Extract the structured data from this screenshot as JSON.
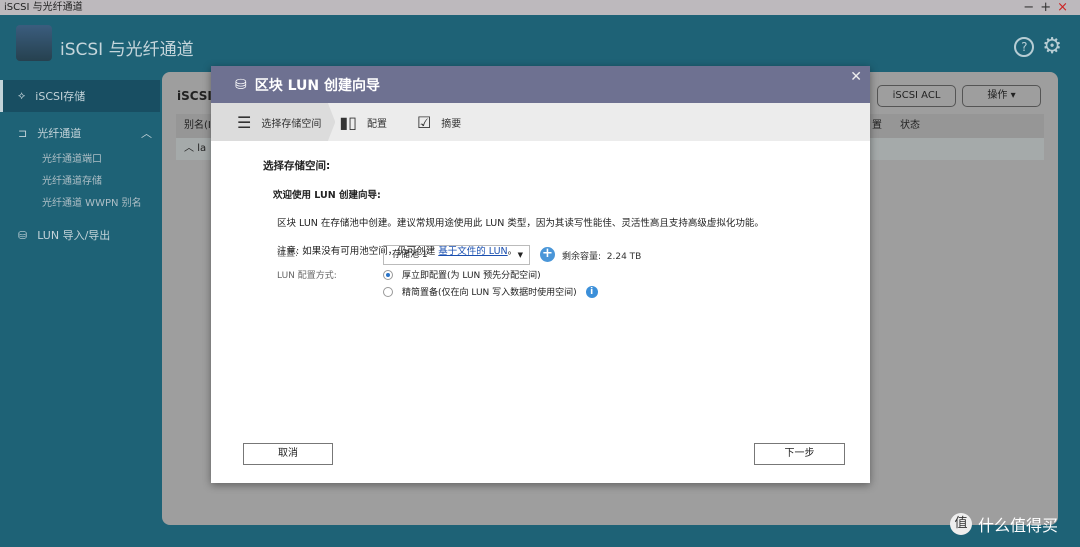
{
  "window": {
    "title": "iSCSI 与光纤通道",
    "controls": [
      "−",
      "+",
      "×"
    ]
  },
  "app": {
    "title": "iSCSI 与光纤通道"
  },
  "sidebar": {
    "items": [
      {
        "label": "iSCSI存储"
      },
      {
        "label": "光纤通道",
        "subitems": [
          "光纤通道端口",
          "光纤通道存储",
          "光纤通道 WWPN 别名"
        ]
      },
      {
        "label": "LUN 导入/导出"
      }
    ]
  },
  "panel": {
    "title": "iSCSI",
    "acl_button": "iSCSI ACL",
    "action_button": "操作",
    "columns": [
      "别名(IQ",
      "置",
      "状态"
    ],
    "row": "la"
  },
  "dialog": {
    "title": "区块 LUN 创建向导",
    "steps": [
      "选择存储空间",
      "配置",
      "摘要"
    ],
    "heading": "选择存储空间:",
    "welcome": "欢迎使用 LUN 创建向导:",
    "description": "区块 LUN 在存储池中创建。建议常规用途使用此 LUN 类型，因为其读写性能佳、灵活性高且支持高级虚拟化功能。",
    "note_prefix": "注意: 如果没有可用池空间，仍可创建 ",
    "note_link": "基于文件的 LUN",
    "note_suffix": "。",
    "location_label": "位置:",
    "location_value": "存储池 1",
    "capacity_label": "剩余容量:",
    "capacity_value": "2.24 TB",
    "provision_label": "LUN 配置方式:",
    "options": [
      "厚立即配置(为 LUN 预先分配空间)",
      "精简置备(仅在向 LUN 写入数据时使用空间)"
    ],
    "selected_option": 0,
    "cancel": "取消",
    "next": "下一步"
  },
  "watermark": {
    "badge": "值",
    "text": "什么值得买"
  }
}
